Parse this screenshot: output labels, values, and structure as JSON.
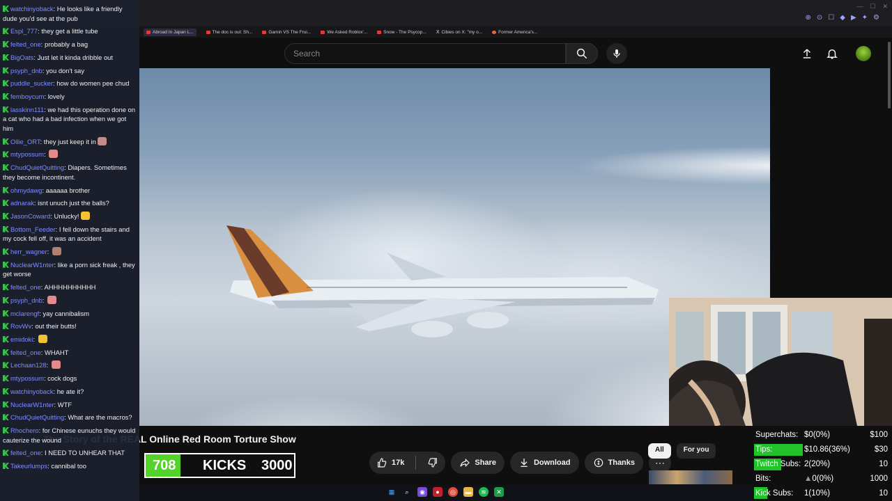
{
  "browser": {
    "bookmarks": [
      "Abroad In Japan L...",
      "The doc is out: Sh...",
      "Gamin VS The Frui...",
      "We Asked Roblox'...",
      "Snow - The Psycop...",
      "Cibies on X: \"my o...",
      "Former America's..."
    ]
  },
  "youtube": {
    "search_placeholder": "Search",
    "video_title": "The Story of the REAL Online Red Room Torture Show",
    "likes": "17k",
    "share_label": "Share",
    "download_label": "Download",
    "thanks_label": "Thanks",
    "chip_all": "All",
    "chip_for_you": "For you"
  },
  "kicks_goal": {
    "current": "708",
    "label": "KICKS",
    "goal": "3000",
    "progress": 0.236
  },
  "stats": [
    {
      "label": "Superchats:",
      "value": "$0(0%)",
      "goal": "$100",
      "progress": 0.0
    },
    {
      "label": "Tips:",
      "value": "$10.86(36%)",
      "goal": "$30",
      "progress": 0.36
    },
    {
      "label": "Twitch Subs:",
      "value": "2(20%)",
      "goal": "10",
      "progress": 0.2
    },
    {
      "label": "Bits:",
      "value": "0(0%)",
      "goal": "1000",
      "progress": 0.0
    },
    {
      "label": "Kick Subs:",
      "value": "1(10%)",
      "goal": "10",
      "progress": 0.1
    }
  ],
  "chat": [
    {
      "user": "watchinyoback",
      "text": "He looks like a friendly dude you'd see at the pub"
    },
    {
      "user": "Espl_777",
      "text": "they get a little tube"
    },
    {
      "user": "felted_one",
      "text": "probably a bag"
    },
    {
      "user": "BigOats",
      "text": "Just let it kinda dribble out"
    },
    {
      "user": "psyph_dnb",
      "text": "you don't say"
    },
    {
      "user": "puddle_sucker",
      "text": "how do women pee chud"
    },
    {
      "user": "femboycum",
      "text": "lovely"
    },
    {
      "user": "lasskinn111",
      "text": "we had this operation done on a cat who had a bad infection when we got him"
    },
    {
      "user": "Ollie_ORT",
      "text": "they just keep it in",
      "emote": "#c58a8a"
    },
    {
      "user": "mtypossum",
      "text": "",
      "emote": "#e38b8b"
    },
    {
      "user": "ChudQuietQuitting",
      "text": "Diapers. Sometimes they become incontinent."
    },
    {
      "user": "ohmydawg",
      "text": "aaaaaa brother"
    },
    {
      "user": "adnarak",
      "text": "isnt unuch just the balls?"
    },
    {
      "user": "JasonCoward",
      "text": "Unlucky!",
      "emote": "#f2c230"
    },
    {
      "user": "Bottom_Feeder",
      "text": "I fell down the stairs and my cock fell off, it was an accident"
    },
    {
      "user": "herr_wagner",
      "text": "",
      "emote": "#b08070"
    },
    {
      "user": "NuclearW1nter",
      "text": "like a porn sick freak , they get worse"
    },
    {
      "user": "felted_one",
      "text": "AHHHHHHHHHH"
    },
    {
      "user": "psyph_dnb",
      "text": "",
      "emote": "#e38b8b"
    },
    {
      "user": "mclarengf",
      "text": "yay cannibalism"
    },
    {
      "user": "RovWv",
      "text": "out their butts!"
    },
    {
      "user": "emidoki",
      "text": "",
      "emote": "#f2c230"
    },
    {
      "user": "felted_one",
      "text": "WHAHT"
    },
    {
      "user": "Lechaan128",
      "text": "",
      "emote": "#e38b8b"
    },
    {
      "user": "mtypossum",
      "text": "cock dogs"
    },
    {
      "user": "watchinyoback",
      "text": "he ate it?"
    },
    {
      "user": "NuclearW1nter",
      "text": "WTF"
    },
    {
      "user": "ChudQuietQuitting",
      "text": "What are the macros?"
    },
    {
      "user": "Rhochero",
      "text": "for Chinese eunuchs they would cauterize the wound"
    },
    {
      "user": "felted_one",
      "text": "I NEED TO UNHEAR THAT"
    },
    {
      "user": "Takeurlumps",
      "text": "cannibal too"
    }
  ]
}
